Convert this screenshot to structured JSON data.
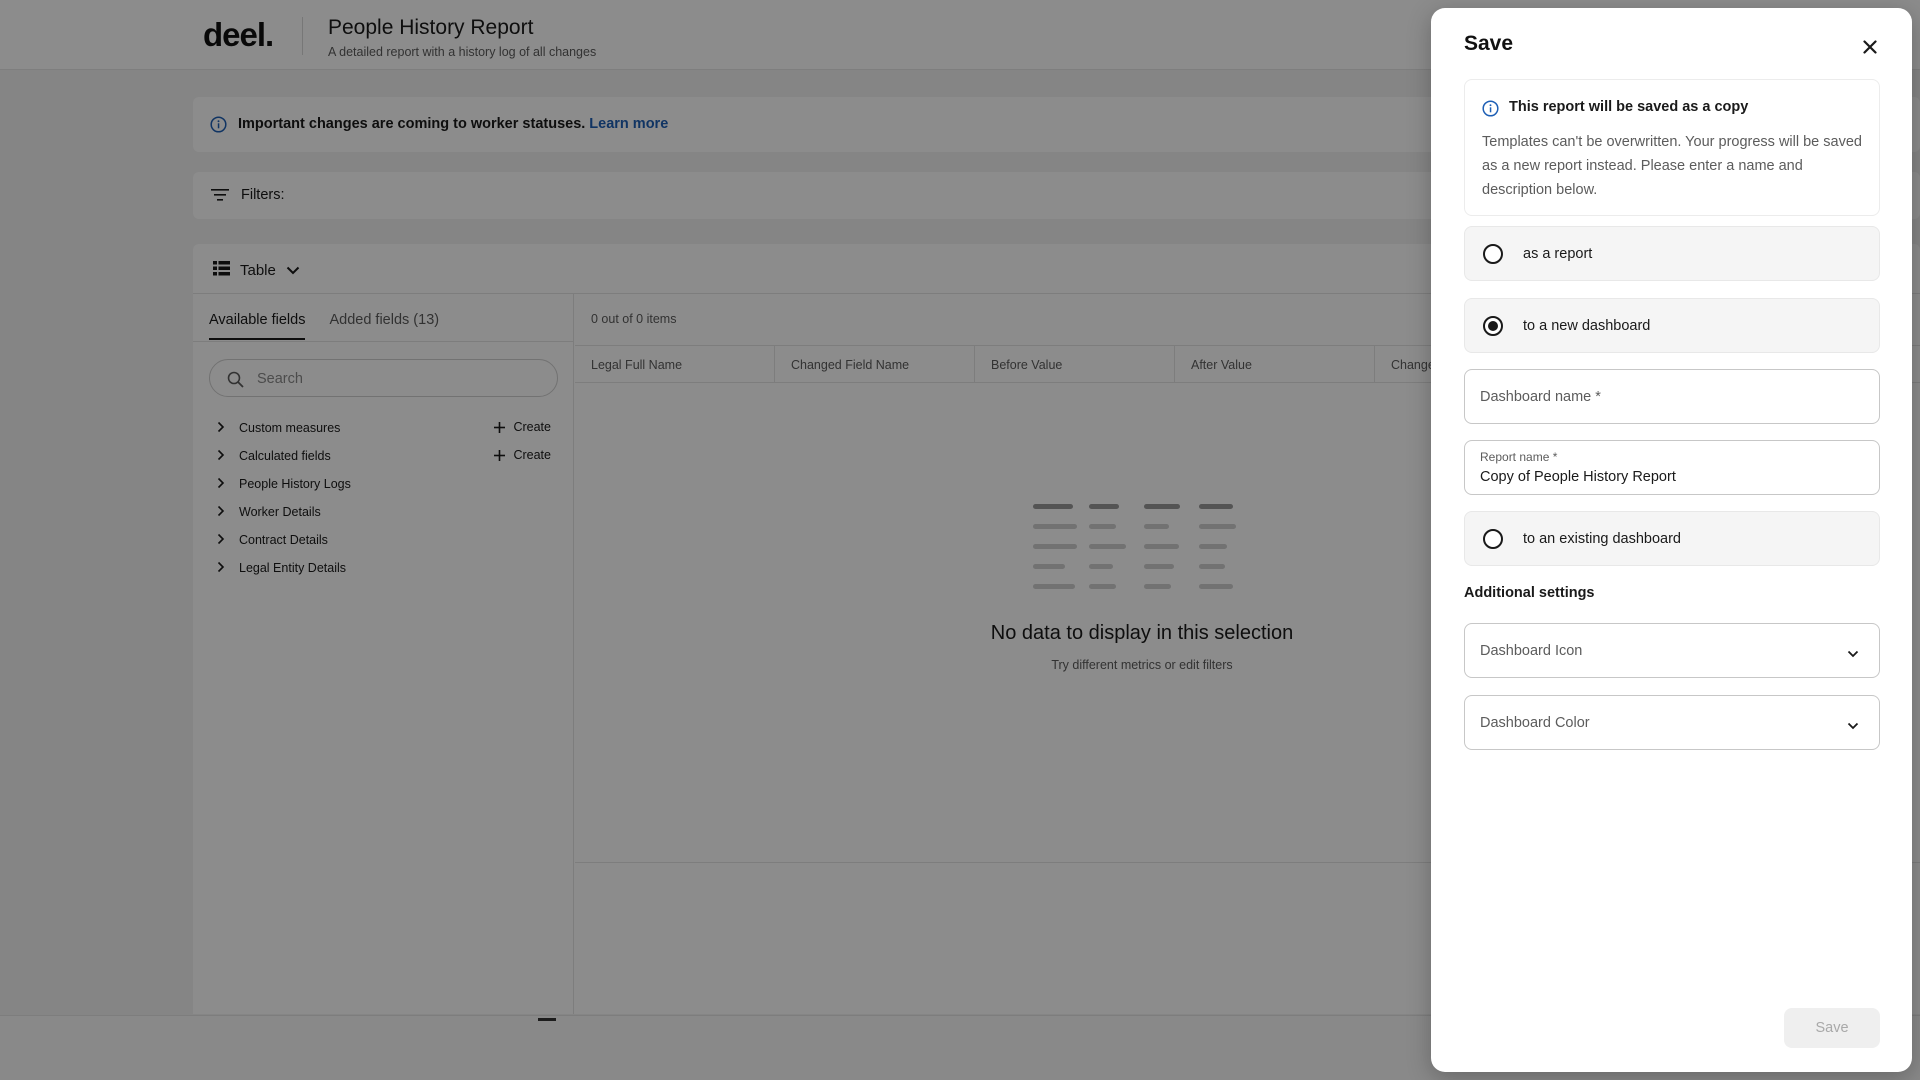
{
  "app": {
    "logo": "deel.",
    "report_title": "People History Report",
    "report_subtitle": "A detailed report with a history log of all changes",
    "banner": {
      "text": "Important changes are coming to worker statuses.",
      "link": "Learn more"
    },
    "filters_label": "Filters:",
    "view_label": "Table",
    "tabs": [
      {
        "label": "Available fields"
      },
      {
        "label": "Added fields (13)"
      }
    ],
    "search_placeholder": "Search",
    "field_groups": [
      {
        "label": "Custom measures",
        "action": "Create"
      },
      {
        "label": "Calculated fields",
        "action": "Create"
      },
      {
        "label": "People History Logs"
      },
      {
        "label": "Worker Details"
      },
      {
        "label": "Contract Details"
      },
      {
        "label": "Legal Entity Details"
      }
    ],
    "items_count": "0 out of 0 items",
    "columns": [
      "Legal Full Name",
      "Changed Field Name",
      "Before Value",
      "After Value",
      "Change"
    ],
    "empty_title": "No data to display in this selection",
    "empty_subtitle": "Try different metrics or edit filters"
  },
  "drawer": {
    "title": "Save",
    "notice": {
      "title": "This report will be saved as a copy",
      "body": "Templates can't be overwritten. Your progress will be saved as a new report instead. Please enter a name and description below."
    },
    "options": [
      {
        "label": "as a report",
        "checked": false
      },
      {
        "label": "to a new dashboard",
        "checked": true
      },
      {
        "label": "to an existing dashboard",
        "checked": false
      }
    ],
    "dashboard_name": {
      "placeholder": "Dashboard name *"
    },
    "report_name": {
      "label": "Report name *",
      "value": "Copy of People History Report"
    },
    "additional_settings_label": "Additional settings",
    "dashboard_icon_placeholder": "Dashboard Icon",
    "dashboard_color_placeholder": "Dashboard Color",
    "save_label": "Save"
  },
  "icons": {
    "info": "info-icon",
    "filter": "filter-icon",
    "table": "table-icon",
    "chevron_down": "chevron-down-icon",
    "chevron_right": "chevron-right-icon",
    "search": "search-icon",
    "plus": "plus-icon",
    "close": "close-icon"
  },
  "colors": {
    "link": "#1e5fb5",
    "overlay": "rgba(0,0,0,0.45)",
    "primary_text": "#1a1a1a",
    "disabled_text": "#a9a9a9"
  }
}
